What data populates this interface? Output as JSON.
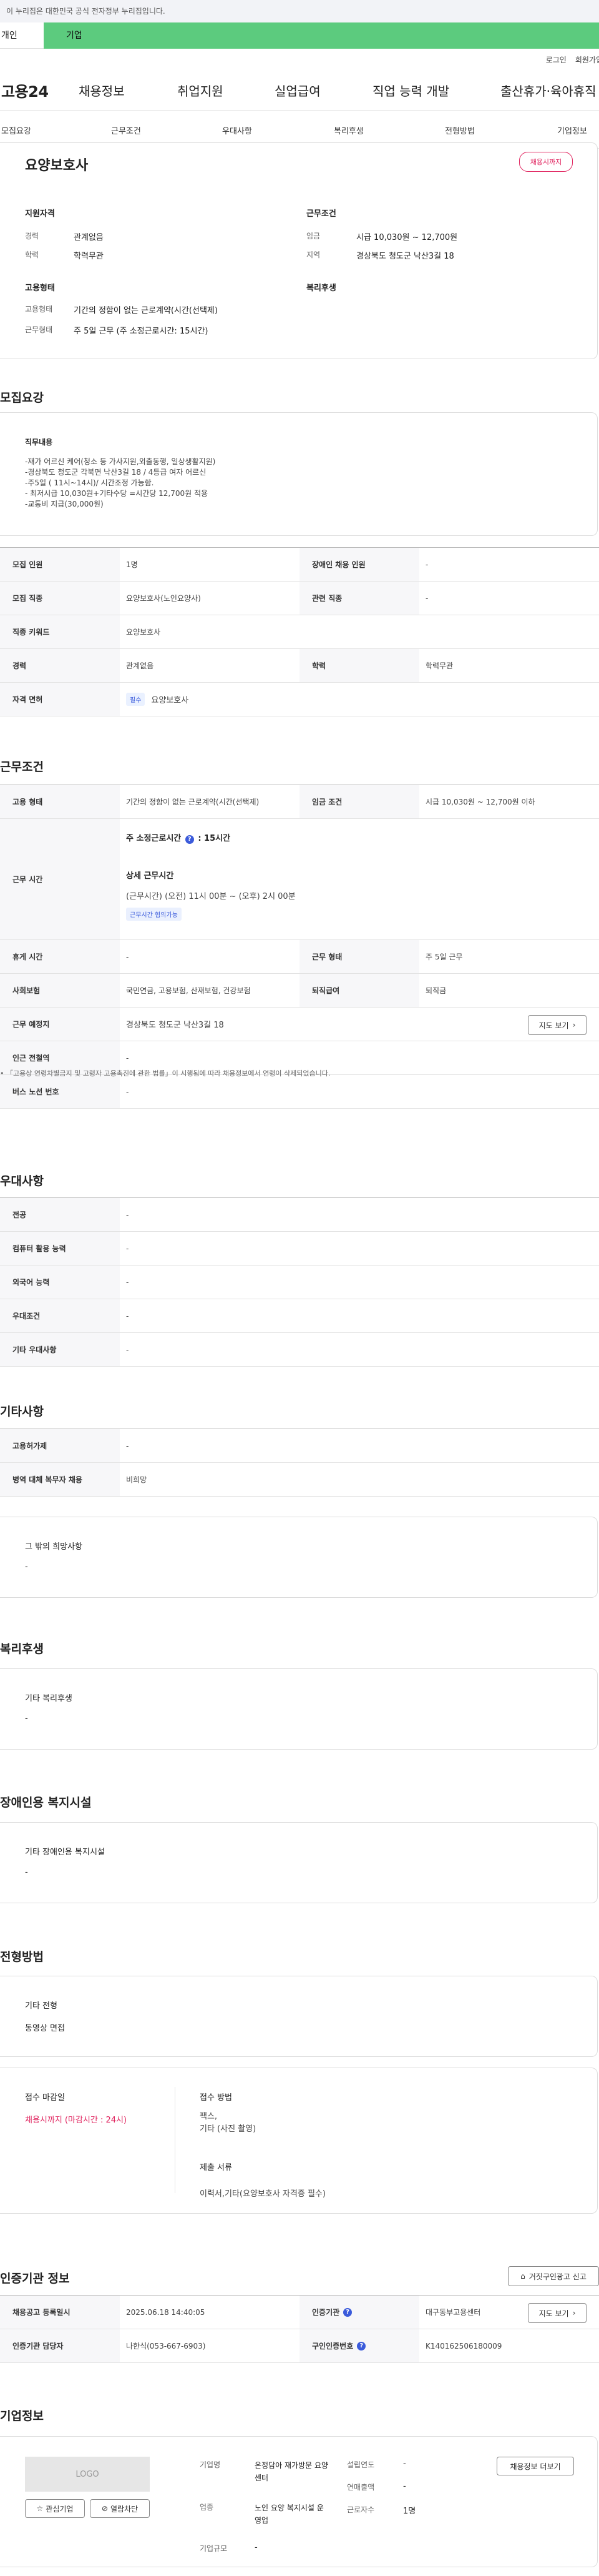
{
  "gov_notice": "이 누리집은 대한민국 공식 전자정부 누리집입니다.",
  "type_tabs": {
    "personal": "개인",
    "company": "기업"
  },
  "util": {
    "login": "로그인",
    "join": "회원가입"
  },
  "gnb": {
    "logo": "고용24",
    "menus": [
      "채용정보",
      "취업지원",
      "실업급여",
      "직업 능력 개발",
      "출산휴가·육아휴직"
    ]
  },
  "subnav": [
    "모집요강",
    "근무조건",
    "우대사항",
    "복리후생",
    "전형방법",
    "기업정보"
  ],
  "summary": {
    "title": "요양보호사",
    "status_badge": "채용시까지",
    "qual_title": "지원자격",
    "career_label": "경력",
    "career_value": "관계없음",
    "edu_label": "학력",
    "edu_value": "학력무관",
    "cond_title": "근무조건",
    "wage_label": "임금",
    "wage_value": "시급 10,030원 ~ 12,700원",
    "region_label": "지역",
    "region_value": "경상북도 청도군 낙산3길 18",
    "emp_title": "고용형태",
    "emp_type_label": "고용형태",
    "emp_type_value": "기간의 정함이 없는 근로계약(시간(선택제)",
    "work_type_label": "근무형태",
    "work_type_value": "주 5일 근무 (주 소정근로시간: 15시간)",
    "welfare_title": "복리후생"
  },
  "recruit": {
    "section_title": "모집요강",
    "duty_title": "직무내용",
    "duty_text": "-재가 어르신 케어(청소 등 가사지원,외출동행, 일상생활지원)\n-경상북도 청도군 각북면 낙산3길 18 /  4등급 여자 어르신\n-주5일 ( 11시~14시)/ 시간조정 가능함.\n- 최저시급 10,030원+기타수당 =시간당 12,700원 적용\n-교통비 지급(30,000원)",
    "rows": [
      {
        "l1": "모집 인원",
        "v1": "1명",
        "l2": "장애인 채용 인원",
        "v2": "-"
      },
      {
        "l1": "모집 직종",
        "v1": "요양보호사(노인요양사)",
        "l2": "관련 직종",
        "v2": "-"
      },
      {
        "l1": "직종 키워드",
        "v1": "요양보호사"
      },
      {
        "l1": "경력",
        "v1": "관계없음",
        "l2": "학력",
        "v2": "학력무관"
      },
      {
        "l1": "자격 면허",
        "tag": "필수",
        "v1": "요양보호사"
      }
    ]
  },
  "work": {
    "section_title": "근무조건",
    "emp_label": "고용 형태",
    "emp_value": "기간의 정함이 없는 근로계약(시간(선택제)",
    "wage_label": "임금 조건",
    "wage_value": "시급 10,030원 ~ 12,700원 이하",
    "hours_label": "근무 시간",
    "hours_weekly_prefix": "주 소정근로시간",
    "hours_weekly_value": ": 15시간",
    "hours_detail_title": "상세 근무시간",
    "hours_detail_value": "(근무시간) (오전) 11시 00분 ~ (오후) 2시 00분",
    "hours_tag": "근무시간 협의가능",
    "break_label": "휴게 시간",
    "break_value": "-",
    "form_label": "근무 형태",
    "form_value": "주 5일 근무",
    "insurance_label": "사회보험",
    "insurance_value": "국민연금, 고용보험, 산재보험, 건강보험",
    "retire_label": "퇴직급여",
    "retire_value": "퇴직금",
    "place_label": "근무 예정지",
    "place_value": "경상북도 청도군 낙산3길 18",
    "map_button": "지도 보기",
    "station_label": "인근 전철역",
    "station_value": "-",
    "bus_label": "버스 노선 번호",
    "bus_value": "-",
    "note": "「고용상 연령차별금지 및 고령자 고용촉진에 관한 법률」이 시행됨에 따라 채용정보에서 연령이 삭제되었습니다."
  },
  "preference": {
    "section_title": "우대사항",
    "rows": [
      {
        "label": "전공",
        "value": "-"
      },
      {
        "label": "컴퓨터 활용 능력",
        "value": "-"
      },
      {
        "label": "외국어 능력",
        "value": "-"
      },
      {
        "label": "우대조건",
        "value": "-"
      },
      {
        "label": "기타 우대사항",
        "value": "-"
      }
    ]
  },
  "etc": {
    "section_title": "기타사항",
    "rows": [
      {
        "label": "고용허가제",
        "value": "-"
      },
      {
        "label": "병역 대체 복무자 채용",
        "value": "비희망"
      }
    ],
    "other_title": "그 밖의 희망사항",
    "other_value": "-"
  },
  "welfare": {
    "section_title": "복리후생",
    "box_title": "기타 복리후생",
    "box_value": "-"
  },
  "disabled": {
    "section_title": "장애인용 복지시설",
    "box_title": "기타 장애인용 복지시설",
    "box_value": "-"
  },
  "screening": {
    "section_title": "전형방법",
    "other_title": "기타 전형",
    "other_value": "동영상 면접",
    "deadline_title": "접수 마감일",
    "deadline_value": "채용시까지 (마감시간 : 24시)",
    "method_title": "접수 방법",
    "method_value": "팩스,\n기타 (사진 촬영)",
    "docs_title": "제출 서류",
    "docs_value": "이력서,기타(요양보호사 자격증 필수)"
  },
  "agency": {
    "section_title": "인증기관 정보",
    "report_button": "거짓구인광고 신고",
    "reg_label": "채용공고 등록일시",
    "reg_value": "2025.06.18 14:40:05",
    "agency_label": "인증기관",
    "agency_value": "대구동부고용센터",
    "map_button": "지도 보기",
    "manager_label": "인증기관 담당자",
    "manager_value": "나한식(053-667-6903)",
    "jobno_label": "구인인증번호",
    "jobno_value": "K140162506180009"
  },
  "company": {
    "section_title": "기업정보",
    "logo_text": "LOGO",
    "fav_button": "관심기업",
    "block_button": "열람차단",
    "name_label": "기업명",
    "name_value": "온정담아 재가방문 요양센터",
    "biz_label": "업종",
    "biz_value": "노인 요양 복지시설 운영업",
    "size_label": "기업규모",
    "size_value": "-",
    "year_label": "설립연도",
    "year_value": "-",
    "sales_label": "연매출액",
    "sales_value": "-",
    "staff_label": "근로자수",
    "staff_value": "1명",
    "jobs_button": "채용정보 더보기"
  },
  "colors": {
    "brand_green": "#5ccb7e",
    "deadline_red": "#e0235e",
    "info_blue": "#3b5bdb"
  }
}
